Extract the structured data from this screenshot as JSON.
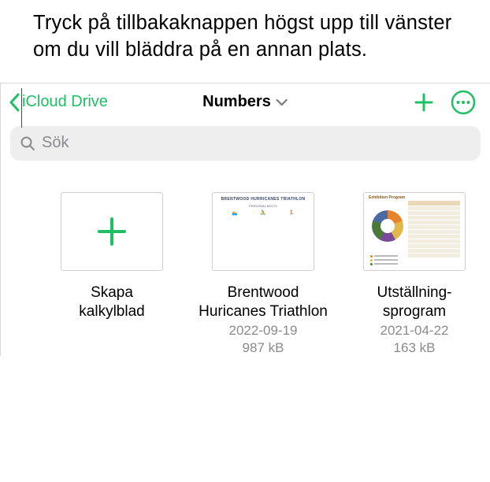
{
  "callout": "Tryck på tillbakaknappen högst upp till vänster om du vill bläddra på en annan plats.",
  "nav": {
    "back_label": "iCloud Drive",
    "title": "Numbers"
  },
  "search": {
    "placeholder": "Sök"
  },
  "tiles": {
    "create": {
      "title_line1": "Skapa",
      "title_line2": "kalkylblad"
    },
    "doc1": {
      "title_line1": "Brentwood",
      "title_line2": "Huricanes Triathlon",
      "date": "2022-09-19",
      "size": "987 kB",
      "thumb_header": "BRENTWOOD HURRICANES TRIATHLON",
      "thumb_sub": "PERSONAL BESTS"
    },
    "doc2": {
      "title_line1": "Utställning-",
      "title_line2": "sprogram",
      "date": "2021-04-22",
      "size": "163 kB",
      "thumb_header": "Exhibition Program"
    }
  },
  "colors": {
    "accent": "#1fbf63",
    "muted": "#8a8a8e"
  }
}
